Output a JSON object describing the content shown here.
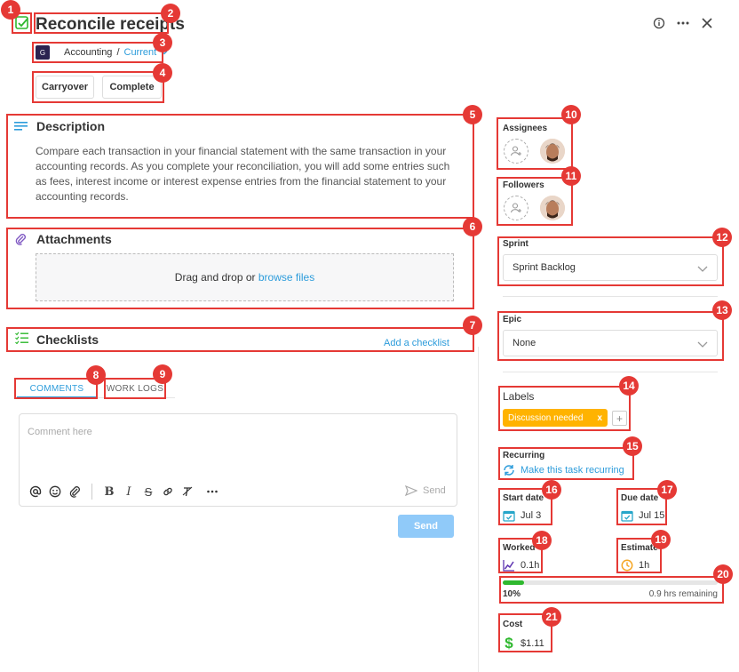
{
  "header": {
    "title": "Reconcile receipts",
    "breadcrumb": {
      "badge": "G",
      "project": "Accounting",
      "separator": "/",
      "sprint": "Current"
    },
    "buttons": {
      "carryover": "Carryover",
      "complete": "Complete"
    },
    "icons": [
      "info-icon",
      "more-icon",
      "close-icon"
    ]
  },
  "description": {
    "title": "Description",
    "text": "Compare each transaction in your financial statement with the same transaction in your accounting records. As you complete your reconciliation, you will add some entries such as fees, interest income or interest expense entries from the financial statement to your accounting records."
  },
  "attachments": {
    "title": "Attachments",
    "drop_text": "Drag and drop or ",
    "browse_link": "browse files"
  },
  "checklists": {
    "title": "Checklists",
    "add_link": "Add a checklist"
  },
  "tabs": {
    "comments": "COMMENTS",
    "work_logs": "WORK LOGS"
  },
  "comment": {
    "placeholder": "Comment here",
    "inline_send": "Send",
    "send_button": "Send"
  },
  "sidebar": {
    "assignees": "Assignees",
    "followers": "Followers",
    "sprint": {
      "label": "Sprint",
      "value": "Sprint Backlog"
    },
    "epic": {
      "label": "Epic",
      "value": "None"
    },
    "labels": {
      "label": "Labels",
      "tag": "Discussion needed",
      "remove": "x",
      "add": "+"
    },
    "recurring": {
      "label": "Recurring",
      "link": "Make this task recurring"
    },
    "start_date": {
      "label": "Start date",
      "value": "Jul 3"
    },
    "due_date": {
      "label": "Due date",
      "value": "Jul 15"
    },
    "worked": {
      "label": "Worked",
      "value": "0.1h"
    },
    "estimate": {
      "label": "Estimate",
      "value": "1h"
    },
    "progress": {
      "percent_text": "10%",
      "fraction": 0.1,
      "remaining": "0.9 hrs remaining"
    },
    "cost": {
      "label": "Cost",
      "value": "$1.11"
    }
  },
  "markers": [
    "1",
    "2",
    "3",
    "4",
    "5",
    "6",
    "7",
    "8",
    "9",
    "10",
    "11",
    "12",
    "13",
    "14",
    "15",
    "16",
    "17",
    "18",
    "19",
    "20",
    "21"
  ],
  "colors": {
    "accent": "#2d9cdb",
    "annotation": "#e53935",
    "tag": "#ffb300",
    "progress": "#2eb82e",
    "send_disabled": "#90caf9"
  }
}
